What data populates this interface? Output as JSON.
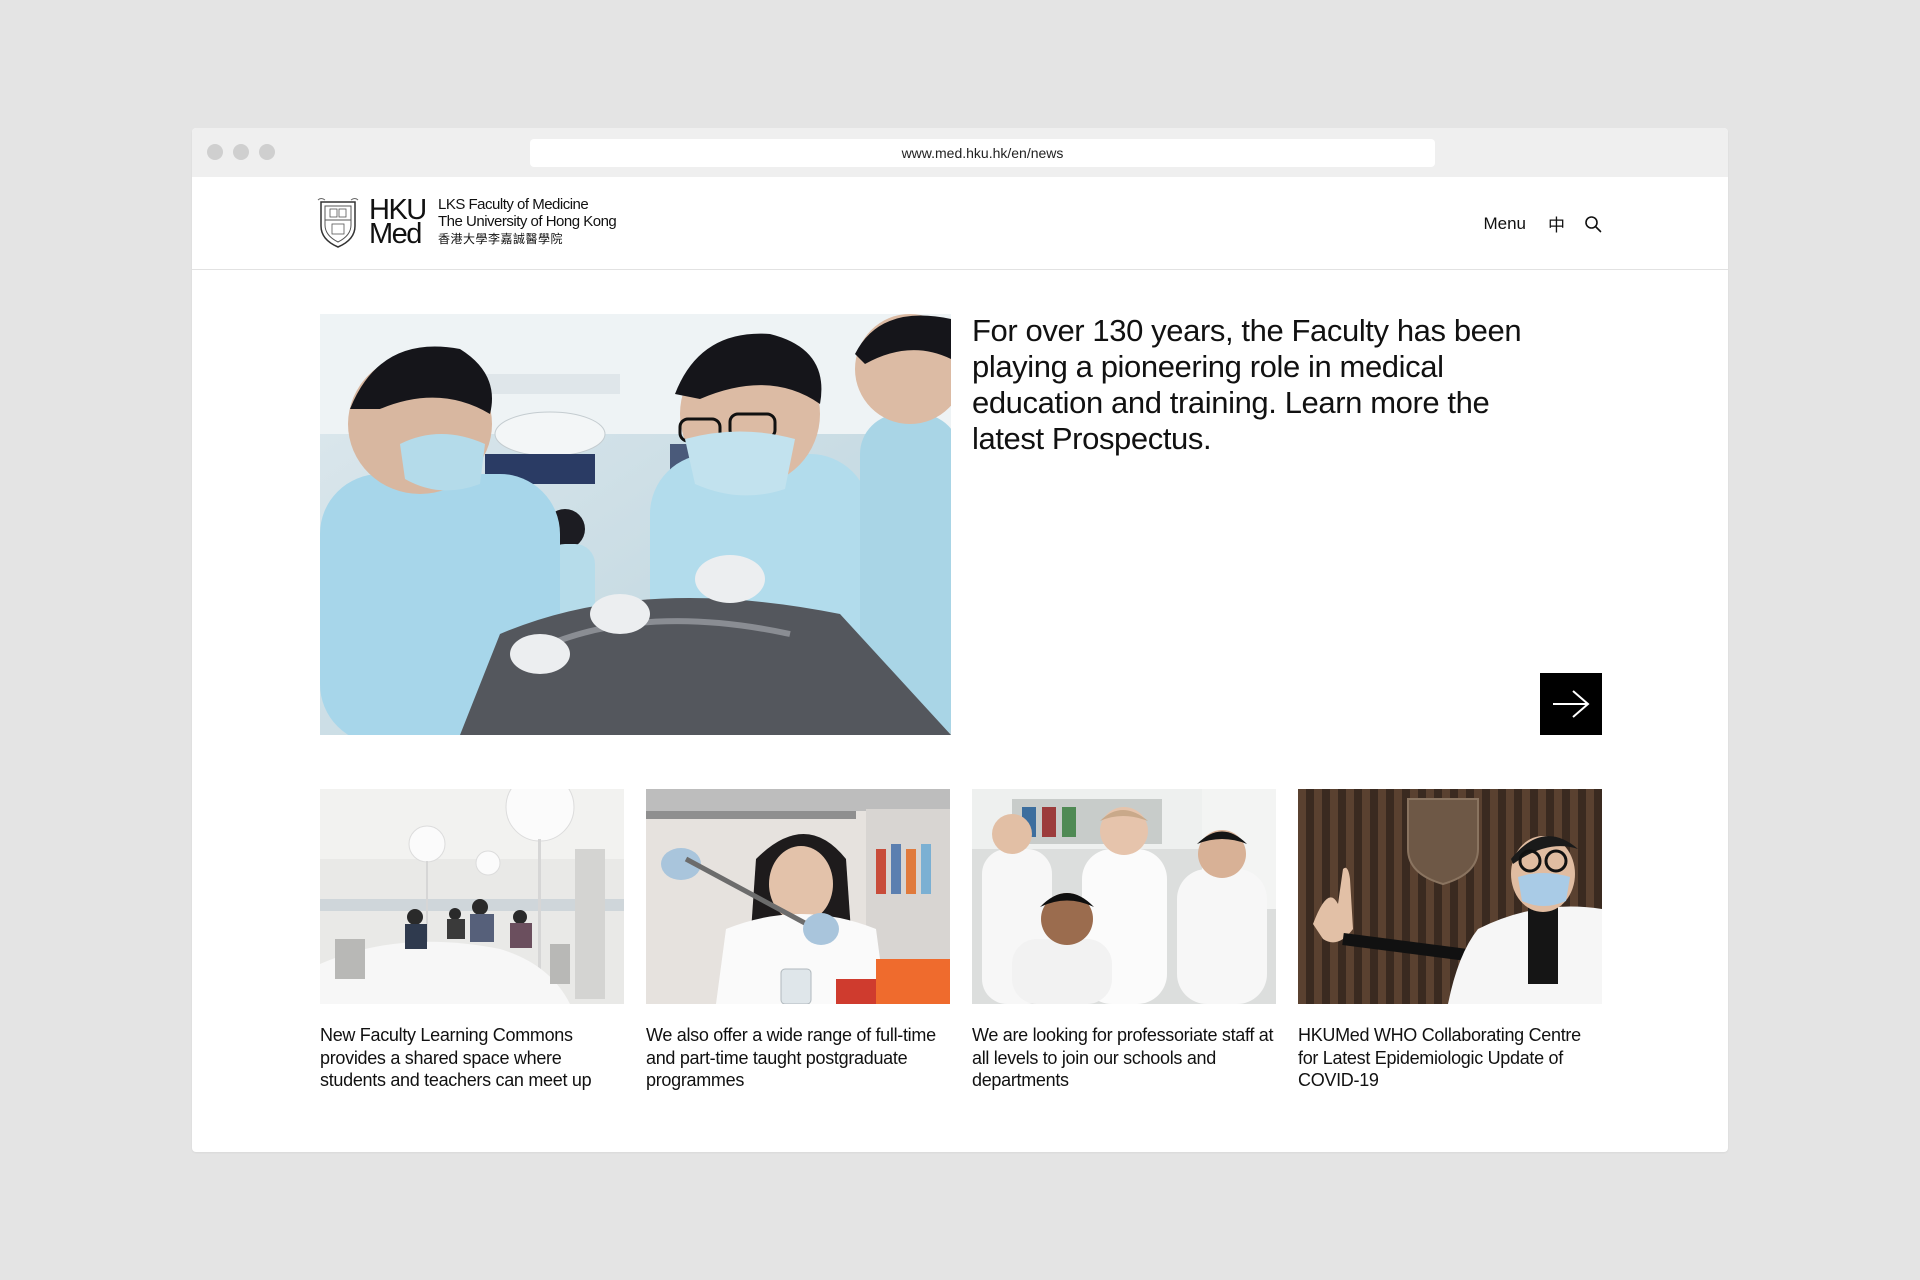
{
  "browser": {
    "url": "www.med.hku.hk/en/news"
  },
  "header": {
    "wordmark_line1": "HKU",
    "wordmark_line2": "Med",
    "faculty_line1": "LKS Faculty of Medicine",
    "faculty_line2": "The University of Hong Kong",
    "faculty_line3": "香港大學李嘉誠醫學院",
    "menu_label": "Menu",
    "lang_label": "中",
    "icons": {
      "search": "search-icon",
      "crest": "university-crest-icon"
    }
  },
  "hero": {
    "text": "For over 130 years, the Faculty has been playing a pioneering role in medical education and training. Learn more the latest Prospectus.",
    "next_icon": "arrow-right-icon"
  },
  "cards": [
    {
      "caption": "New Faculty Learning Commons provides a shared space where students and teachers can meet up"
    },
    {
      "caption": "We also offer a wide range of full-time and part-time taught postgraduate programmes"
    },
    {
      "caption": "We are looking for professoriate staff at all levels to join our schools and departments"
    },
    {
      "caption": "HKUMed WHO Collaborating Centre for Latest Epidemiologic Update of COVID-19"
    }
  ],
  "colors": {
    "page_background": "#e4e4e4",
    "chrome": "#efefef",
    "text": "#111111",
    "button": "#000000"
  }
}
